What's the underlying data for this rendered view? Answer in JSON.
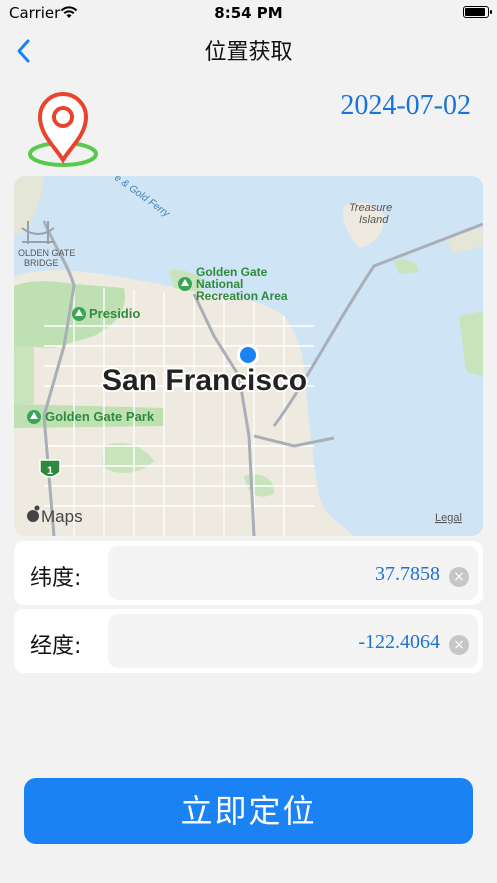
{
  "status_bar": {
    "carrier": "Carrier",
    "time": "8:54 PM"
  },
  "nav": {
    "title": "位置获取"
  },
  "date": "2024-07-02",
  "map": {
    "city_label": "San Francisco",
    "labels": {
      "treasure_island": [
        "Treasure",
        "Island"
      ],
      "golden_gate_recreation": [
        "Golden Gate",
        "National",
        "Recreation Area"
      ],
      "presidio": "Presidio",
      "golden_gate_park": "Golden Gate Park",
      "bridge": [
        "OLDEN GATE",
        "BRIDGE"
      ],
      "ferry": "e & Gold Ferry",
      "route_shield": "1",
      "maps_logo": "Maps",
      "legal": "Legal"
    }
  },
  "latitude": {
    "label": "纬度:",
    "value": "37.7858"
  },
  "longitude": {
    "label": "经度:",
    "value": "-122.4064"
  },
  "clear_glyph": "×",
  "locate_button": {
    "label": "立即定位"
  },
  "colors": {
    "accent": "#1a82f2",
    "value_text": "#1a73d6",
    "pin": "#e8432d",
    "pin_base": "#58c94a"
  }
}
